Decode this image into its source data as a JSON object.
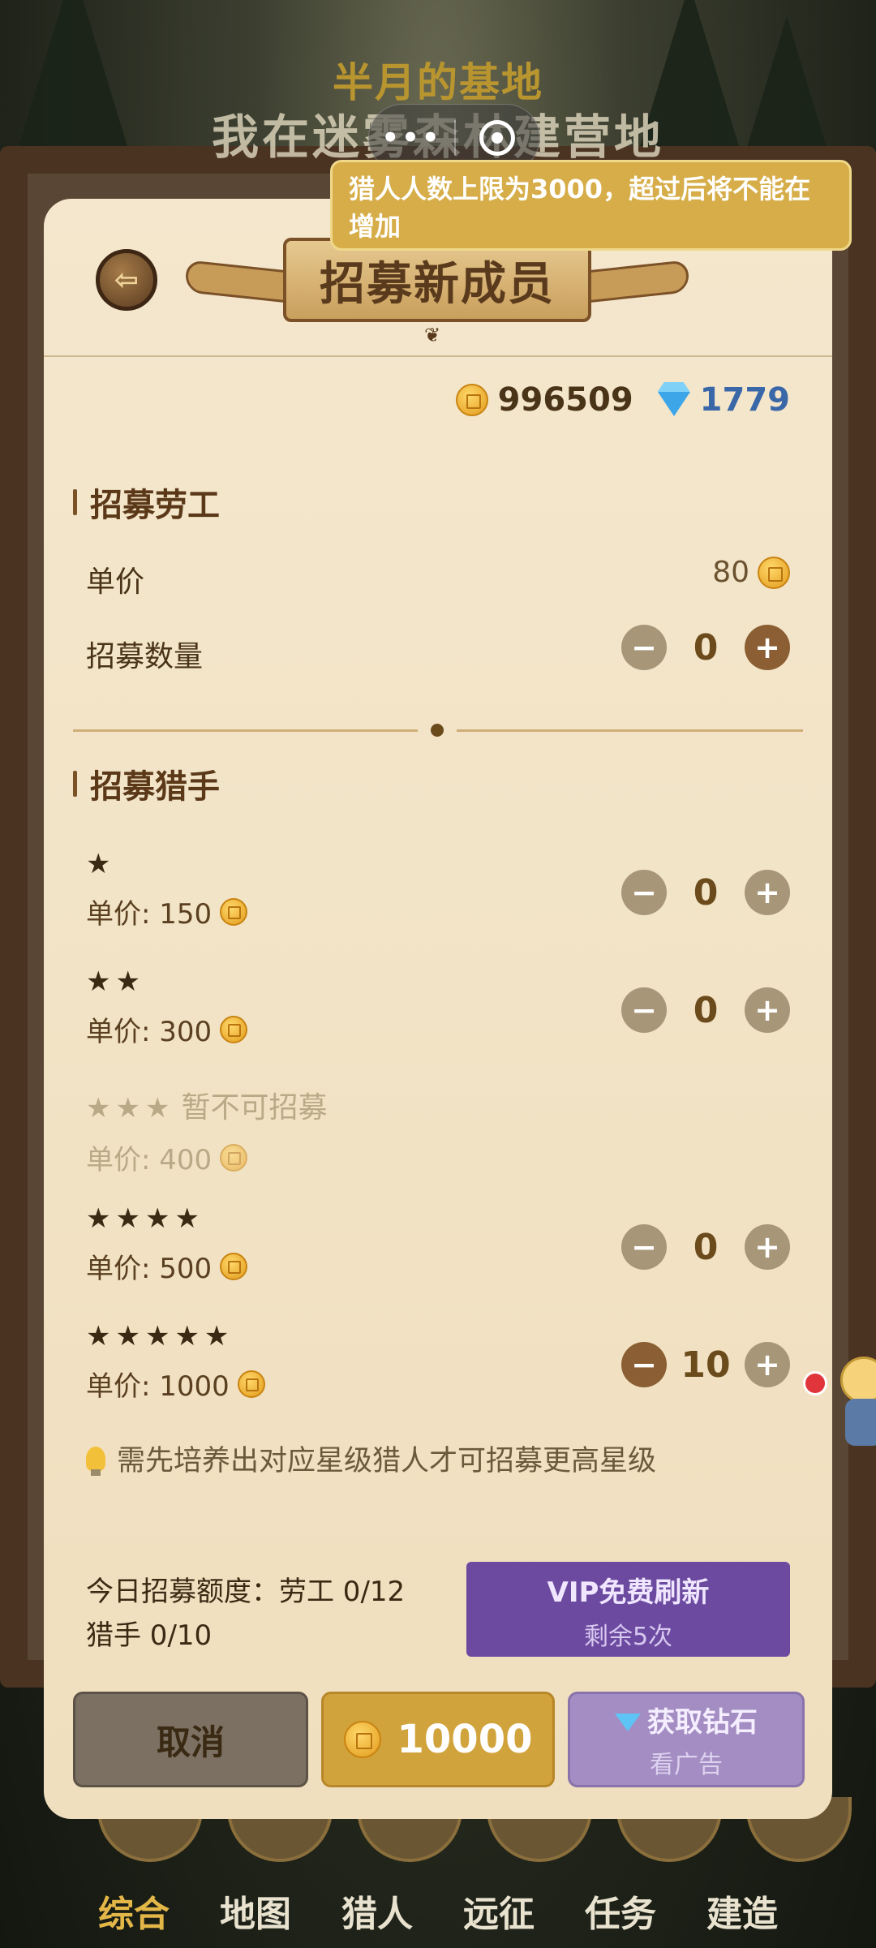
{
  "background": {
    "title_line1": "半月的基地",
    "title_line2": "我在迷雾森林建营地",
    "bottom_nav": [
      "综合",
      "地图",
      "猎人",
      "远征",
      "任务",
      "建造"
    ]
  },
  "capsule": {
    "more_icon": "more-dots-icon",
    "close_icon": "target-close-icon"
  },
  "toast": {
    "text": "猎人人数上限为3000，超过后将不能在增加"
  },
  "modal": {
    "title": "招募新成员",
    "currency": {
      "gold": "996509",
      "gems": "1779"
    },
    "labor": {
      "section_title": "招募劳工",
      "unit_price_label": "单价",
      "unit_price": "80",
      "quantity_label": "招募数量",
      "quantity": "0"
    },
    "hunters": {
      "section_title": "招募猎手",
      "items": [
        {
          "stars": "★",
          "price_text": "单价: 150",
          "quantity": "0"
        },
        {
          "stars": "★★",
          "price_text": "单价: 300",
          "quantity": "0"
        },
        {
          "stars": "★★★",
          "unavailable": "暂不可招募",
          "price_text": "单价: 400"
        },
        {
          "stars": "★★★★",
          "price_text": "单价: 500",
          "quantity": "0"
        },
        {
          "stars": "★★★★★",
          "price_text": "单价: 1000",
          "quantity": "10"
        }
      ]
    },
    "tip": "需先培养出对应星级猎人才可招募更高星级",
    "quota": {
      "line1": "今日招募额度：劳工 0/12",
      "line2": "猎手 0/10"
    },
    "vip": {
      "label": "VIP免费刷新",
      "remaining": "剩余5次"
    },
    "buttons": {
      "cancel": "取消",
      "total_cost": "10000",
      "get_gems": "获取钻石",
      "watch_ad": "看广告"
    }
  },
  "colors": {
    "modal_bg": "#f2e4c8",
    "accent_gold": "#d1a33c",
    "vip_purple": "#6b4aa0",
    "gem_blue": "#3a67a8",
    "toast_bg": "#d6ad48"
  }
}
